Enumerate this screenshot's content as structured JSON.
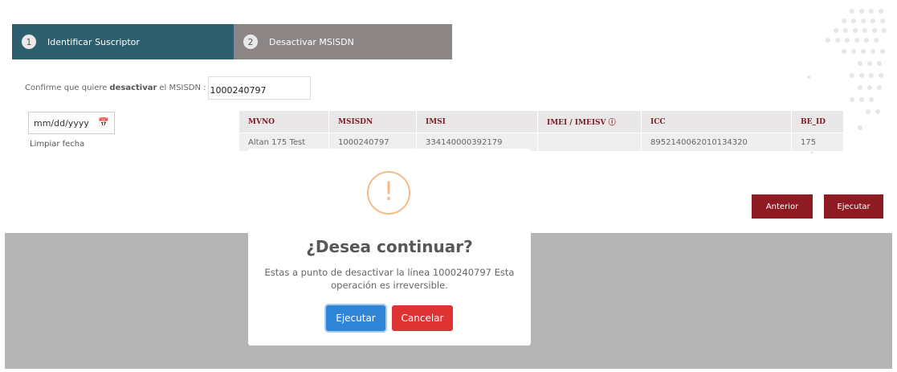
{
  "steps": [
    {
      "num": "1",
      "label": "Identificar Suscriptor"
    },
    {
      "num": "2",
      "label": "Desactivar MSISDN"
    }
  ],
  "confirm": {
    "prefix": "Confirme que quiere",
    "bold": "desactivar",
    "suffix": "el MSISDN :",
    "msisdn_value": "1000240797"
  },
  "date_input": {
    "placeholder": "mm/dd/yyyy",
    "clear_label": "Limpiar fecha"
  },
  "table": {
    "headers": [
      "MVNO",
      "MSISDN",
      "IMSI",
      "IMEI / IMEISV ⓘ",
      "ICC",
      "BE_ID"
    ],
    "row": [
      "Altan 175 Test",
      "1000240797",
      "334140000392179",
      "",
      "8952140062010134320",
      "175"
    ]
  },
  "actions": {
    "back_label": "Anterior",
    "execute_label": "Ejecutar"
  },
  "modal": {
    "icon": "!",
    "title": "¿Desea continuar?",
    "text": "Estas a punto de desactivar la línea 1000240797 Esta operación es irreversible.",
    "confirm_label": "Ejecutar",
    "cancel_label": "Cancelar"
  },
  "colors": {
    "step_active": "#2e5f6e",
    "step_inactive": "#8c8586",
    "brand_red": "#8e1b22",
    "confirm_blue": "#3085d6",
    "cancel_red": "#dd3333",
    "warning": "#f8bb86"
  }
}
